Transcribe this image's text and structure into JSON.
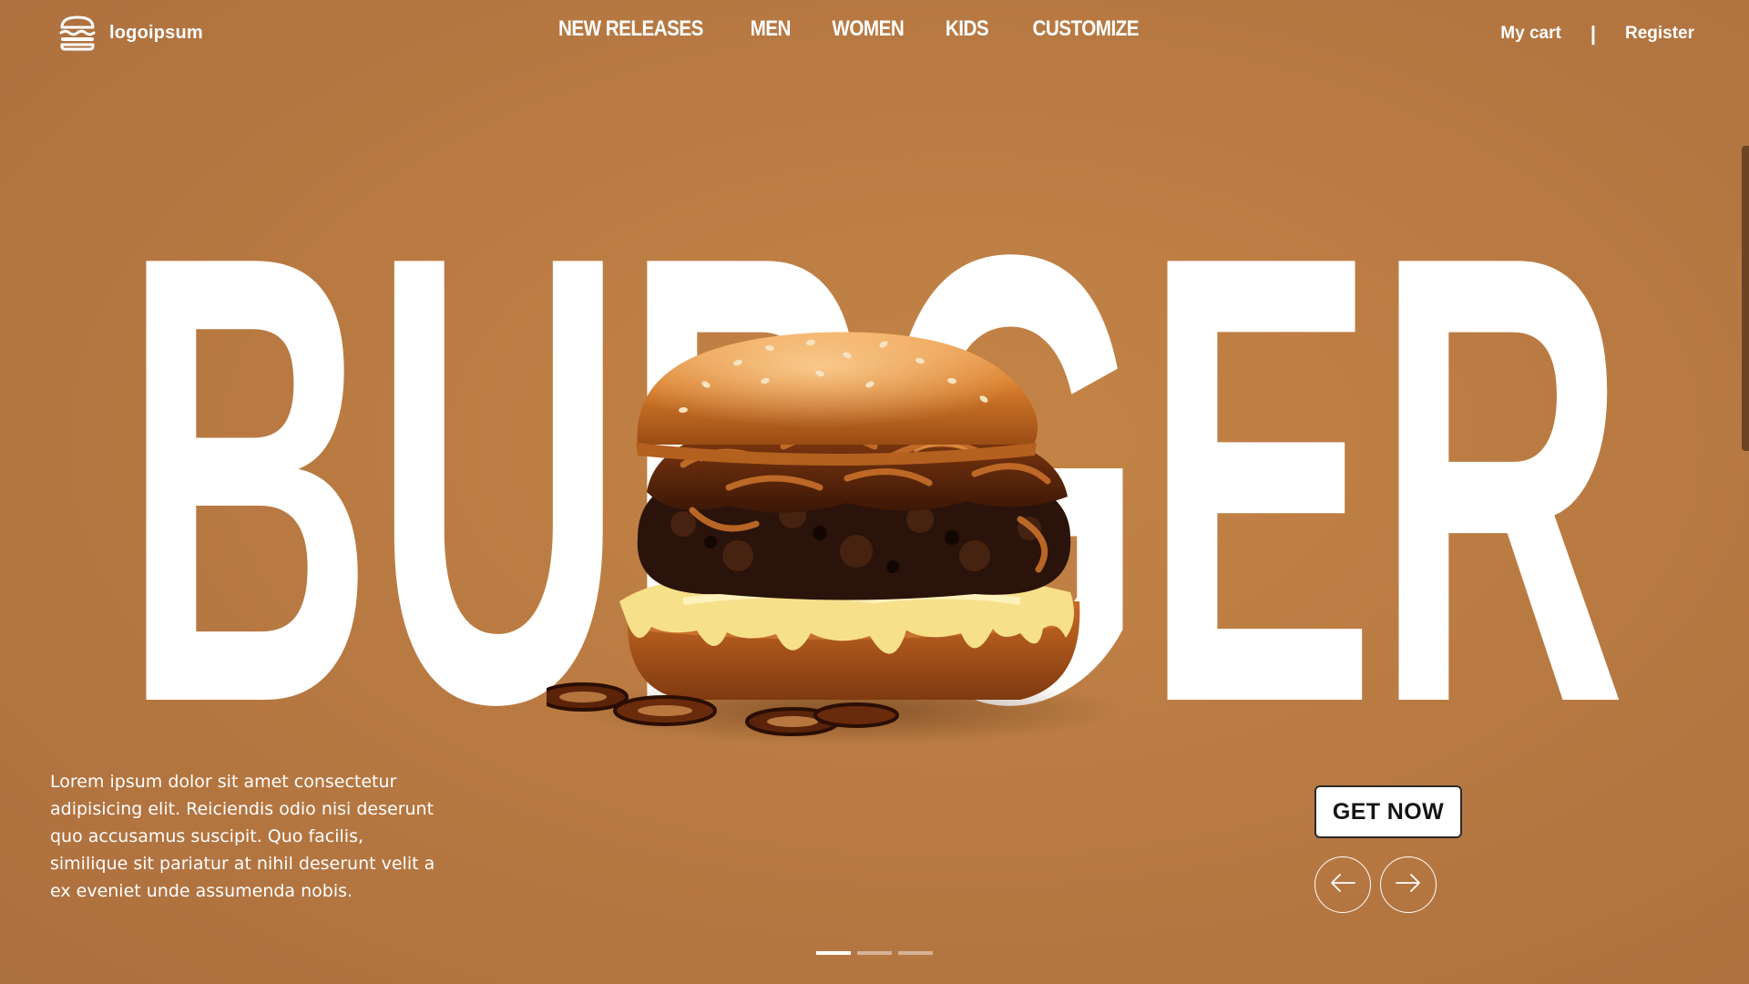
{
  "brand": {
    "logo_text": "logoipsum",
    "logo_icon": "burger-icon"
  },
  "nav": {
    "items": [
      {
        "label": "NEW RELEASES"
      },
      {
        "label": "MEN"
      },
      {
        "label": "WOMEN"
      },
      {
        "label": "KIDS"
      },
      {
        "label": "CUSTOMIZE"
      }
    ]
  },
  "account": {
    "cart_label": "My cart",
    "separator": "|",
    "register_label": "Register"
  },
  "hero": {
    "headline": "BURGER",
    "image": "burger-with-caramelized-onions-and-cheese",
    "description": "Lorem ipsum dolor sit amet consectetur adipisicing elit. Reiciendis odio nisi deserunt quo accusamus suscipit. Quo facilis, similique sit pariatur at nihil deserunt velit a ex eveniet unde assumenda nobis.",
    "cta_label": "GET NOW",
    "prev_icon": "arrow-left-icon",
    "next_icon": "arrow-right-icon"
  },
  "slider": {
    "slide_count": 3,
    "active_slide": 1
  },
  "colors": {
    "background": "#bb7c43",
    "text": "#ffffff",
    "cta_bg": "#ffffff",
    "cta_text": "#141414"
  }
}
